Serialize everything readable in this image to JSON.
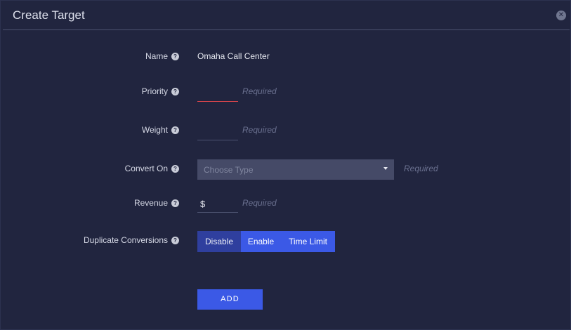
{
  "modal": {
    "title": "Create Target",
    "close_icon": "close-icon"
  },
  "form": {
    "name": {
      "label": "Name",
      "value": "Omaha Call Center"
    },
    "priority": {
      "label": "Priority",
      "required": "Required"
    },
    "weight": {
      "label": "Weight",
      "required": "Required"
    },
    "convert_on": {
      "label": "Convert On",
      "placeholder": "Choose Type",
      "required": "Required"
    },
    "revenue": {
      "label": "Revenue",
      "prefix": "$",
      "required": "Required"
    },
    "duplicate_conversions": {
      "label": "Duplicate Conversions",
      "options": [
        "Disable",
        "Enable",
        "Time Limit"
      ],
      "selected": "Disable"
    },
    "help_icon": "?"
  },
  "actions": {
    "add_label": "ADD"
  },
  "colors": {
    "background": "#21253f",
    "accent": "#3b59e6",
    "selected_segment": "#2f3f9e",
    "error_underline": "#d8454c",
    "required_text": "#6b7190"
  }
}
